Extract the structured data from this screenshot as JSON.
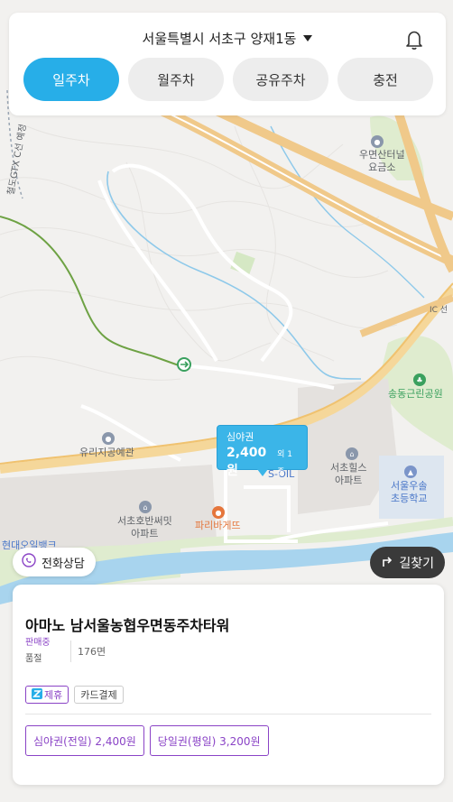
{
  "header": {
    "location": "서울특별시 서초구 양재1동",
    "tabs": [
      {
        "label": "일주차",
        "active": true
      },
      {
        "label": "월주차",
        "active": false
      },
      {
        "label": "공유주차",
        "active": false
      },
      {
        "label": "충전",
        "active": false
      }
    ]
  },
  "map": {
    "labels": {
      "woomyeon_tollgate": "우면산터널\n요금소",
      "songdong_park": "송동근린공원",
      "seocho_hills": "서초힐스\n아파트",
      "seoul_woosol": "서울우솔\n초등학교",
      "yurizi_park": "유리지공예관",
      "seocho_banpo": "서초호반써밋\n아파트",
      "paris_baguette": "파리바게뜨",
      "gtx_line": "철도GTX C선 예정",
      "s_oil": "S-OIL",
      "bank_partial": "현대오일뱅크",
      "ic_label": "IC 선"
    }
  },
  "marker": {
    "title": "심야권",
    "price": "2,400원",
    "extra": "외 1종"
  },
  "buttons": {
    "phone": "전화상담",
    "route": "길찾기"
  },
  "card": {
    "title": "아마노 남서울농협우면동주차타워",
    "sale_status": "판매중",
    "stock_status": "품절",
    "spaces": "176면",
    "badges": {
      "partner": "제휴",
      "card": "카드결제"
    },
    "tickets": [
      "심야권(전일) 2,400원",
      "당일권(평일) 3,200원"
    ]
  },
  "colors": {
    "accent": "#27aee8",
    "purple": "#8a43c6",
    "dark_button": "#3a3a3a"
  }
}
